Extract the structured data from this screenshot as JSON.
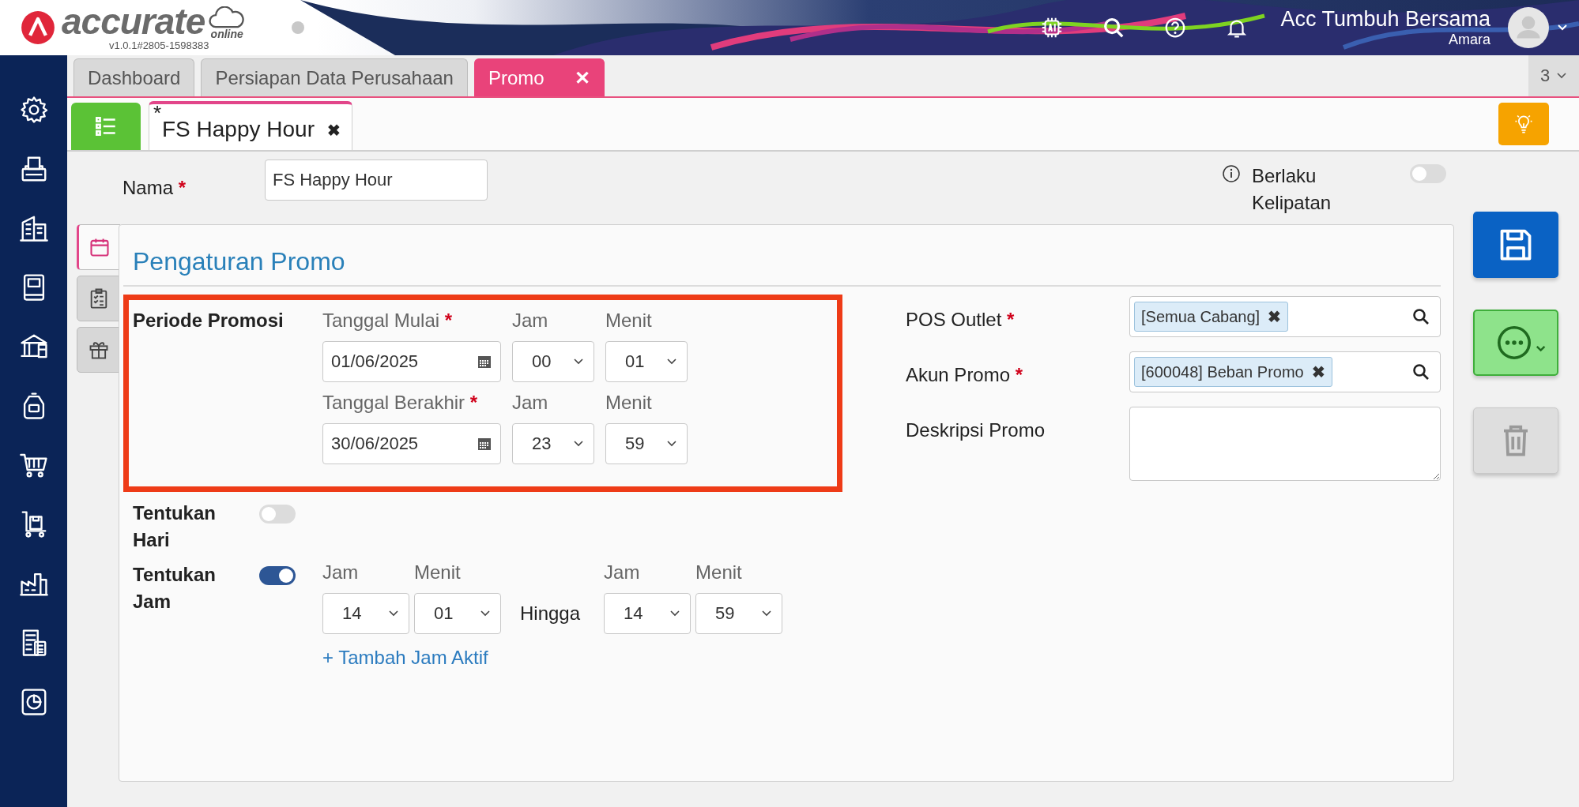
{
  "header": {
    "logo_text": "accurate",
    "logo_sub": "online",
    "version": "v1.0.1#2805-1598383",
    "company": "Acc Tumbuh Bersama",
    "user": "Amara"
  },
  "tabs": [
    {
      "label": "Dashboard",
      "selected": false
    },
    {
      "label": "Persiapan Data Perusahaan",
      "selected": false
    },
    {
      "label": "Promo",
      "selected": true,
      "close": "✕"
    }
  ],
  "tab_count": "3",
  "doc_tab": {
    "mark": "*",
    "label": "FS Happy Hour",
    "close": "✖"
  },
  "name_field": {
    "label": "Nama",
    "mark": "*",
    "value": "FS Happy Hour"
  },
  "berlaku_kelipatan": {
    "label": "Berlaku Kelipatan",
    "on": false
  },
  "side_tabs": [
    {
      "kind": "calendar",
      "selected": true
    },
    {
      "kind": "checklist",
      "selected": false
    },
    {
      "kind": "gift",
      "selected": false
    }
  ],
  "panel": {
    "title": "Pengaturan Promo",
    "period": {
      "label": "Periode Promosi",
      "highlighted": true,
      "rows": [
        {
          "date_label": "Tanggal Mulai",
          "mark": "*",
          "date": "01/06/2025",
          "hour_label": "Jam",
          "hour": "00",
          "minute_label": "Menit",
          "minute": "01"
        },
        {
          "date_label": "Tanggal Berakhir",
          "mark": "*",
          "date": "30/06/2025",
          "hour_label": "Jam",
          "hour": "23",
          "minute_label": "Menit",
          "minute": "59"
        }
      ]
    },
    "tentukan_hari": {
      "label": "Tentukan Hari",
      "on": false
    },
    "tentukan_jam": {
      "label": "Tentukan Jam",
      "on": true,
      "ranges": [
        {
          "from_hour_label": "Jam",
          "from_hour": "14",
          "from_minute_label": "Menit",
          "from_minute": "01",
          "separator": "Hingga",
          "to_hour_label": "Jam",
          "to_hour": "14",
          "to_minute_label": "Menit",
          "to_minute": "59"
        }
      ],
      "add_link": "+ Tambah Jam Aktif"
    },
    "right_fields": [
      {
        "kind": "lookup",
        "label": "POS Outlet",
        "mark": "*",
        "tags": [
          {
            "text": "[Semua Cabang]",
            "remove": "✖"
          }
        ]
      },
      {
        "kind": "lookup",
        "label": "Akun Promo",
        "mark": "*",
        "tags": [
          {
            "text": "[600048] Beban Promo",
            "remove": "✖"
          }
        ]
      },
      {
        "kind": "textarea",
        "label": "Deskripsi Promo"
      }
    ]
  }
}
